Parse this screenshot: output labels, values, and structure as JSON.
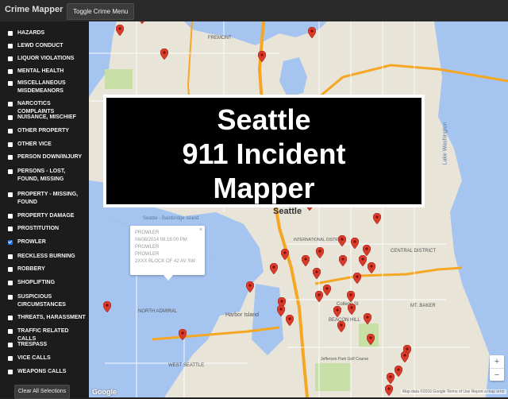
{
  "app": {
    "title": "Crime Mapper",
    "toggle_label": "Toggle Crime Menu"
  },
  "sidebar": {
    "items": [
      {
        "label": "HAZARDS",
        "checked": false
      },
      {
        "label": "LEWD CONDUCT",
        "checked": false
      },
      {
        "label": "LIQUOR VIOLATIONS",
        "checked": false
      },
      {
        "label": "MENTAL HEALTH",
        "checked": false
      },
      {
        "label": "MISCELLANEOUS MISDEMEANORS",
        "checked": false
      },
      {
        "label": "NARCOTICS COMPLAINTS",
        "checked": false
      },
      {
        "label": "NUISANCE, MISCHIEF",
        "checked": false
      },
      {
        "label": "OTHER PROPERTY",
        "checked": false
      },
      {
        "label": "OTHER VICE",
        "checked": false
      },
      {
        "label": "PERSON DOWN/INJURY",
        "checked": false
      },
      {
        "label": "PERSONS - LOST, FOUND, MISSING",
        "checked": false
      },
      {
        "label": "PROPERTY - MISSING, FOUND",
        "checked": false
      },
      {
        "label": "PROPERTY DAMAGE",
        "checked": false
      },
      {
        "label": "PROSTITUTION",
        "checked": false
      },
      {
        "label": "PROWLER",
        "checked": true
      },
      {
        "label": "RECKLESS BURNING",
        "checked": false
      },
      {
        "label": "ROBBERY",
        "checked": false
      },
      {
        "label": "SHOPLIFTING",
        "checked": false
      },
      {
        "label": "SUSPICIOUS CIRCUMSTANCES",
        "checked": false
      },
      {
        "label": "THREATS, HARASSMENT",
        "checked": false
      },
      {
        "label": "TRAFFIC RELATED CALLS",
        "checked": false
      },
      {
        "label": "TRESPASS",
        "checked": false
      },
      {
        "label": "VICE CALLS",
        "checked": false
      },
      {
        "label": "WEAPONS CALLS",
        "checked": false
      }
    ],
    "clear_label": "Clear All Selections"
  },
  "map": {
    "labels": {
      "seattle": "Seattle",
      "lake_washington": "Lake Washington",
      "harbor_island": "Harbor Island",
      "ferry": "Seattle - Bainbridge Island",
      "west_seattle": "WEST SEATTLE",
      "beacon_hill": "BEACON HILL",
      "international_district": "INTERNATIONAL DISTRICT",
      "mount_baker": "MT. BAKER",
      "jefferson_park": "Jefferson Park Golf Course",
      "north_admiral": "NORTH ADMIRAL",
      "central_district": "CENTRAL DISTRICT",
      "fremont": "FREMONT",
      "college_st": "College St"
    },
    "popup": {
      "category": "PROWLER",
      "datetime": "06/08/2014 08:16:00 PM",
      "line1": "PROWLER",
      "line2": "PROWLER",
      "address": "2XXX BLOCK OF 42 AV SW"
    },
    "zoom_in": "+",
    "zoom_out": "−",
    "footer": "Map data ©2016 Google   Terms of Use   Report a map error",
    "google": "Google"
  },
  "overlay": {
    "line1": "Seattle",
    "line2": "911 Incident",
    "line3": "Mapper"
  },
  "colors": {
    "pin": "#d93b2b",
    "water": "#a5c4f0",
    "park": "#c8dfa8",
    "highway": "#f5a623",
    "road": "#ffffff"
  }
}
